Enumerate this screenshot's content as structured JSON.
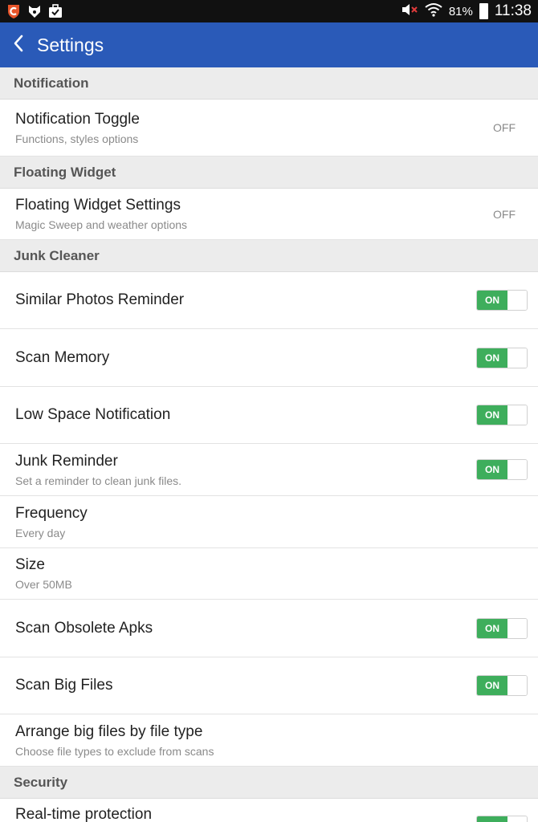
{
  "status_bar": {
    "battery": "81%",
    "time": "11:38",
    "icons_left": [
      "shield-app-icon",
      "fox-app-icon",
      "briefcase-app-icon"
    ],
    "icons_right": [
      "volume-muted-icon",
      "wifi-icon",
      "battery-icon"
    ]
  },
  "app_bar": {
    "title": "Settings",
    "color": "#2a5ab8"
  },
  "colors": {
    "toggle_on": "#3eae5c",
    "section_bg": "#ececec"
  },
  "sections": {
    "notification": "Notification",
    "floating_widget": "Floating Widget",
    "junk_cleaner": "Junk Cleaner",
    "security": "Security"
  },
  "items": {
    "notification_toggle": {
      "title": "Notification Toggle",
      "subtitle": "Functions, styles options",
      "value": "OFF"
    },
    "floating_widget_settings": {
      "title": "Floating Widget Settings",
      "subtitle": "Magic Sweep and weather options",
      "value": "OFF"
    },
    "similar_photos": {
      "title": "Similar Photos Reminder",
      "toggle": "ON"
    },
    "scan_memory": {
      "title": "Scan Memory",
      "toggle": "ON"
    },
    "low_space": {
      "title": "Low Space Notification",
      "toggle": "ON"
    },
    "junk_reminder": {
      "title": "Junk Reminder",
      "subtitle": "Set a reminder to clean junk files.",
      "toggle": "ON"
    },
    "frequency": {
      "title": "Frequency",
      "subtitle": "Every day"
    },
    "size": {
      "title": "Size",
      "subtitle": "Over 50MB"
    },
    "scan_obsolete": {
      "title": "Scan Obsolete Apks",
      "toggle": "ON"
    },
    "scan_big_files": {
      "title": "Scan Big Files",
      "toggle": "ON"
    },
    "arrange_big_files": {
      "title": "Arrange big files by file type",
      "subtitle": "Choose file types to exclude from scans"
    },
    "realtime_protection": {
      "title": "Real-time protection"
    }
  }
}
